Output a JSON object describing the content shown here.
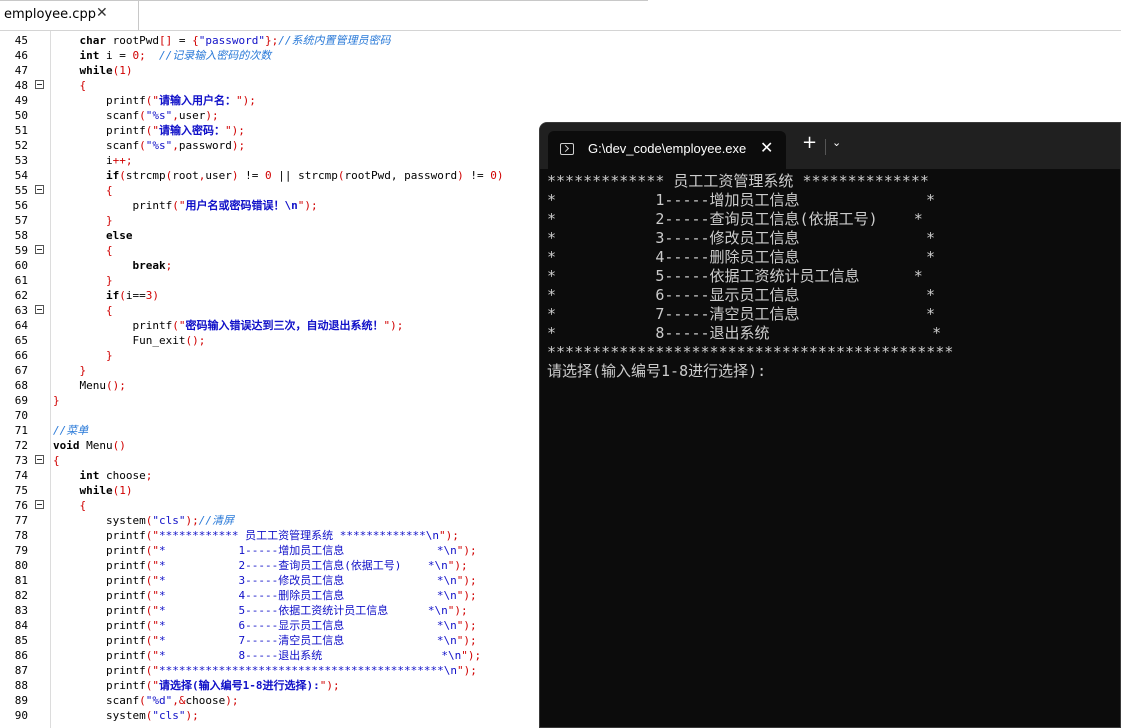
{
  "tab": {
    "label": "employee.cpp",
    "close": "✕"
  },
  "code_lines": [
    {
      "n": "45",
      "fold": false,
      "segs": [
        [
          "    ",
          ""
        ],
        [
          "char",
          "k"
        ],
        [
          " rootPwd",
          ""
        ],
        [
          "[]",
          "p"
        ],
        [
          " = ",
          ""
        ],
        [
          "{",
          "p"
        ],
        [
          "\"password\"",
          "s"
        ],
        [
          "};",
          "p"
        ],
        [
          "//系统内置管理员密码",
          "c"
        ]
      ]
    },
    {
      "n": "46",
      "fold": false,
      "segs": [
        [
          "    ",
          ""
        ],
        [
          "int",
          "k"
        ],
        [
          " i = ",
          ""
        ],
        [
          "0",
          "n"
        ],
        [
          ";  ",
          "p"
        ],
        [
          "//记录输入密码的次数",
          "c"
        ]
      ]
    },
    {
      "n": "47",
      "fold": false,
      "segs": [
        [
          "    ",
          ""
        ],
        [
          "while",
          "k"
        ],
        [
          "(",
          "p"
        ],
        [
          "1",
          "n"
        ],
        [
          ")",
          "p"
        ]
      ]
    },
    {
      "n": "48",
      "fold": true,
      "segs": [
        [
          "    ",
          ""
        ],
        [
          "{",
          "p"
        ]
      ]
    },
    {
      "n": "49",
      "fold": false,
      "segs": [
        [
          "        ",
          ""
        ],
        [
          "printf",
          ""
        ],
        [
          "(\"",
          "p"
        ],
        [
          "请输入用户名：",
          "sb"
        ],
        [
          "\");",
          "p"
        ]
      ]
    },
    {
      "n": "50",
      "fold": false,
      "segs": [
        [
          "        ",
          ""
        ],
        [
          "scanf",
          ""
        ],
        [
          "(",
          "p"
        ],
        [
          "\"%s\"",
          "s"
        ],
        [
          ",",
          "p"
        ],
        [
          "user",
          ""
        ],
        [
          ");",
          "p"
        ]
      ]
    },
    {
      "n": "51",
      "fold": false,
      "segs": [
        [
          "        ",
          ""
        ],
        [
          "printf",
          ""
        ],
        [
          "(\"",
          "p"
        ],
        [
          "请输入密码：",
          "sb"
        ],
        [
          "\");",
          "p"
        ]
      ]
    },
    {
      "n": "52",
      "fold": false,
      "segs": [
        [
          "        ",
          ""
        ],
        [
          "scanf",
          ""
        ],
        [
          "(",
          "p"
        ],
        [
          "\"%s\"",
          "s"
        ],
        [
          ",",
          "p"
        ],
        [
          "password",
          ""
        ],
        [
          ");",
          "p"
        ]
      ]
    },
    {
      "n": "53",
      "fold": false,
      "segs": [
        [
          "        ",
          ""
        ],
        [
          "i",
          ""
        ],
        [
          "++;",
          "p"
        ]
      ]
    },
    {
      "n": "54",
      "fold": false,
      "segs": [
        [
          "        ",
          ""
        ],
        [
          "if",
          "k"
        ],
        [
          "(",
          "p"
        ],
        [
          "strcmp",
          ""
        ],
        [
          "(",
          "p"
        ],
        [
          "root",
          ""
        ],
        [
          ",",
          "p"
        ],
        [
          "user",
          ""
        ],
        [
          ")",
          "p"
        ],
        [
          " != ",
          ""
        ],
        [
          "0",
          "n"
        ],
        [
          " || ",
          ""
        ],
        [
          "strcmp",
          ""
        ],
        [
          "(",
          "p"
        ],
        [
          "rootPwd, password",
          ""
        ],
        [
          ")",
          "p"
        ],
        [
          " != ",
          ""
        ],
        [
          "0",
          "n"
        ],
        [
          ")",
          "p"
        ]
      ]
    },
    {
      "n": "55",
      "fold": true,
      "segs": [
        [
          "        ",
          ""
        ],
        [
          "{",
          "p"
        ]
      ]
    },
    {
      "n": "56",
      "fold": false,
      "segs": [
        [
          "            ",
          ""
        ],
        [
          "printf",
          ""
        ],
        [
          "(\"",
          "p"
        ],
        [
          "用户名或密码错误！\\n",
          "sb"
        ],
        [
          "\");",
          "p"
        ]
      ]
    },
    {
      "n": "57",
      "fold": false,
      "segs": [
        [
          "        ",
          ""
        ],
        [
          "}",
          "p"
        ]
      ]
    },
    {
      "n": "58",
      "fold": false,
      "segs": [
        [
          "        ",
          ""
        ],
        [
          "else",
          "k"
        ]
      ]
    },
    {
      "n": "59",
      "fold": true,
      "segs": [
        [
          "        ",
          ""
        ],
        [
          "{",
          "p"
        ]
      ]
    },
    {
      "n": "60",
      "fold": false,
      "segs": [
        [
          "            ",
          ""
        ],
        [
          "break",
          "k"
        ],
        [
          ";",
          "p"
        ]
      ]
    },
    {
      "n": "61",
      "fold": false,
      "segs": [
        [
          "        ",
          ""
        ],
        [
          "}",
          "p"
        ]
      ]
    },
    {
      "n": "62",
      "fold": false,
      "segs": [
        [
          "        ",
          ""
        ],
        [
          "if",
          "k"
        ],
        [
          "(",
          "p"
        ],
        [
          "i==",
          ""
        ],
        [
          "3",
          "n"
        ],
        [
          ")",
          "p"
        ]
      ]
    },
    {
      "n": "63",
      "fold": true,
      "segs": [
        [
          "        ",
          ""
        ],
        [
          "{",
          "p"
        ]
      ]
    },
    {
      "n": "64",
      "fold": false,
      "segs": [
        [
          "            ",
          ""
        ],
        [
          "printf",
          ""
        ],
        [
          "(\"",
          "p"
        ],
        [
          "密码输入错误达到三次，自动退出系统！",
          "sb"
        ],
        [
          "\");",
          "p"
        ]
      ]
    },
    {
      "n": "65",
      "fold": false,
      "segs": [
        [
          "            ",
          ""
        ],
        [
          "Fun_exit",
          ""
        ],
        [
          "();",
          "p"
        ]
      ]
    },
    {
      "n": "66",
      "fold": false,
      "segs": [
        [
          "        ",
          ""
        ],
        [
          "}",
          "p"
        ]
      ]
    },
    {
      "n": "67",
      "fold": false,
      "segs": [
        [
          "    ",
          ""
        ],
        [
          "}",
          "p"
        ]
      ]
    },
    {
      "n": "68",
      "fold": false,
      "segs": [
        [
          "    ",
          ""
        ],
        [
          "Menu",
          ""
        ],
        [
          "();",
          "p"
        ]
      ]
    },
    {
      "n": "69",
      "fold": false,
      "segs": [
        [
          "",
          ""
        ],
        [
          "}",
          "p"
        ]
      ]
    },
    {
      "n": "70",
      "fold": false,
      "segs": []
    },
    {
      "n": "71",
      "fold": false,
      "segs": [
        [
          "",
          ""
        ],
        [
          "//菜单",
          "c"
        ]
      ]
    },
    {
      "n": "72",
      "fold": false,
      "segs": [
        [
          "",
          ""
        ],
        [
          "void",
          "k"
        ],
        [
          " Menu",
          ""
        ],
        [
          "()",
          "p"
        ]
      ]
    },
    {
      "n": "73",
      "fold": true,
      "segs": [
        [
          "",
          ""
        ],
        [
          "{",
          "p"
        ]
      ]
    },
    {
      "n": "74",
      "fold": false,
      "segs": [
        [
          "    ",
          ""
        ],
        [
          "int",
          "k"
        ],
        [
          " choose",
          ""
        ],
        [
          ";",
          "p"
        ]
      ]
    },
    {
      "n": "75",
      "fold": false,
      "segs": [
        [
          "    ",
          ""
        ],
        [
          "while",
          "k"
        ],
        [
          "(",
          "p"
        ],
        [
          "1",
          "n"
        ],
        [
          ")",
          "p"
        ]
      ]
    },
    {
      "n": "76",
      "fold": true,
      "segs": [
        [
          "    ",
          ""
        ],
        [
          "{",
          "p"
        ]
      ]
    },
    {
      "n": "77",
      "fold": false,
      "segs": [
        [
          "        ",
          ""
        ],
        [
          "system",
          ""
        ],
        [
          "(",
          "p"
        ],
        [
          "\"cls\"",
          "s"
        ],
        [
          ");",
          "p"
        ],
        [
          "//清屏",
          "c"
        ]
      ]
    },
    {
      "n": "78",
      "fold": false,
      "segs": [
        [
          "        ",
          ""
        ],
        [
          "printf",
          ""
        ],
        [
          "(\"",
          "p"
        ],
        [
          "************ 员工工资管理系统 *************\\n",
          "s"
        ],
        [
          "\");",
          "p"
        ]
      ]
    },
    {
      "n": "79",
      "fold": false,
      "segs": [
        [
          "        ",
          ""
        ],
        [
          "printf",
          ""
        ],
        [
          "(\"",
          "p"
        ],
        [
          "*           1-----增加员工信息              *\\n",
          "s"
        ],
        [
          "\");",
          "p"
        ]
      ]
    },
    {
      "n": "80",
      "fold": false,
      "segs": [
        [
          "        ",
          ""
        ],
        [
          "printf",
          ""
        ],
        [
          "(\"",
          "p"
        ],
        [
          "*           2-----查询员工信息(依据工号)    *\\n",
          "s"
        ],
        [
          "\");",
          "p"
        ]
      ]
    },
    {
      "n": "81",
      "fold": false,
      "segs": [
        [
          "        ",
          ""
        ],
        [
          "printf",
          ""
        ],
        [
          "(\"",
          "p"
        ],
        [
          "*           3-----修改员工信息              *\\n",
          "s"
        ],
        [
          "\");",
          "p"
        ]
      ]
    },
    {
      "n": "82",
      "fold": false,
      "segs": [
        [
          "        ",
          ""
        ],
        [
          "printf",
          ""
        ],
        [
          "(\"",
          "p"
        ],
        [
          "*           4-----删除员工信息              *\\n",
          "s"
        ],
        [
          "\");",
          "p"
        ]
      ]
    },
    {
      "n": "83",
      "fold": false,
      "segs": [
        [
          "        ",
          ""
        ],
        [
          "printf",
          ""
        ],
        [
          "(\"",
          "p"
        ],
        [
          "*           5-----依据工资统计员工信息      *\\n",
          "s"
        ],
        [
          "\");",
          "p"
        ]
      ]
    },
    {
      "n": "84",
      "fold": false,
      "segs": [
        [
          "        ",
          ""
        ],
        [
          "printf",
          ""
        ],
        [
          "(\"",
          "p"
        ],
        [
          "*           6-----显示员工信息              *\\n",
          "s"
        ],
        [
          "\");",
          "p"
        ]
      ]
    },
    {
      "n": "85",
      "fold": false,
      "segs": [
        [
          "        ",
          ""
        ],
        [
          "printf",
          ""
        ],
        [
          "(\"",
          "p"
        ],
        [
          "*           7-----清空员工信息              *\\n",
          "s"
        ],
        [
          "\");",
          "p"
        ]
      ]
    },
    {
      "n": "86",
      "fold": false,
      "segs": [
        [
          "        ",
          ""
        ],
        [
          "printf",
          ""
        ],
        [
          "(\"",
          "p"
        ],
        [
          "*           8-----退出系统                  *\\n",
          "s"
        ],
        [
          "\");",
          "p"
        ]
      ]
    },
    {
      "n": "87",
      "fold": false,
      "segs": [
        [
          "        ",
          ""
        ],
        [
          "printf",
          ""
        ],
        [
          "(\"",
          "p"
        ],
        [
          "*******************************************\\n",
          "s"
        ],
        [
          "\");",
          "p"
        ]
      ]
    },
    {
      "n": "88",
      "fold": false,
      "segs": [
        [
          "        ",
          ""
        ],
        [
          "printf",
          ""
        ],
        [
          "(\"",
          "p"
        ],
        [
          "请选择(输入编号1-8进行选择):",
          "sb"
        ],
        [
          "\");",
          "p"
        ]
      ]
    },
    {
      "n": "89",
      "fold": false,
      "segs": [
        [
          "        ",
          ""
        ],
        [
          "scanf",
          ""
        ],
        [
          "(",
          "p"
        ],
        [
          "\"%d\"",
          "s"
        ],
        [
          ",&",
          "p"
        ],
        [
          "choose",
          ""
        ],
        [
          ");",
          "p"
        ]
      ]
    },
    {
      "n": "90",
      "fold": false,
      "segs": [
        [
          "        ",
          ""
        ],
        [
          "system",
          ""
        ],
        [
          "(",
          "p"
        ],
        [
          "\"cls\"",
          "s"
        ],
        [
          ");",
          "p"
        ]
      ]
    }
  ],
  "terminal": {
    "tab_title": "G:\\dev_code\\employee.exe",
    "close": "✕",
    "new_tab": "+",
    "dropdown": "⌄",
    "lines": [
      "************* 员工工资管理系统 **************",
      "*           1-----增加员工信息              *",
      "*           2-----查询员工信息(依据工号)    *",
      "*           3-----修改员工信息              *",
      "*           4-----删除员工信息              *",
      "*           5-----依据工资统计员工信息      *",
      "*           6-----显示员工信息              *",
      "*           7-----清空员工信息              *",
      "*           8-----退出系统                  *",
      "*********************************************",
      "请选择(输入编号1-8进行选择):"
    ]
  }
}
